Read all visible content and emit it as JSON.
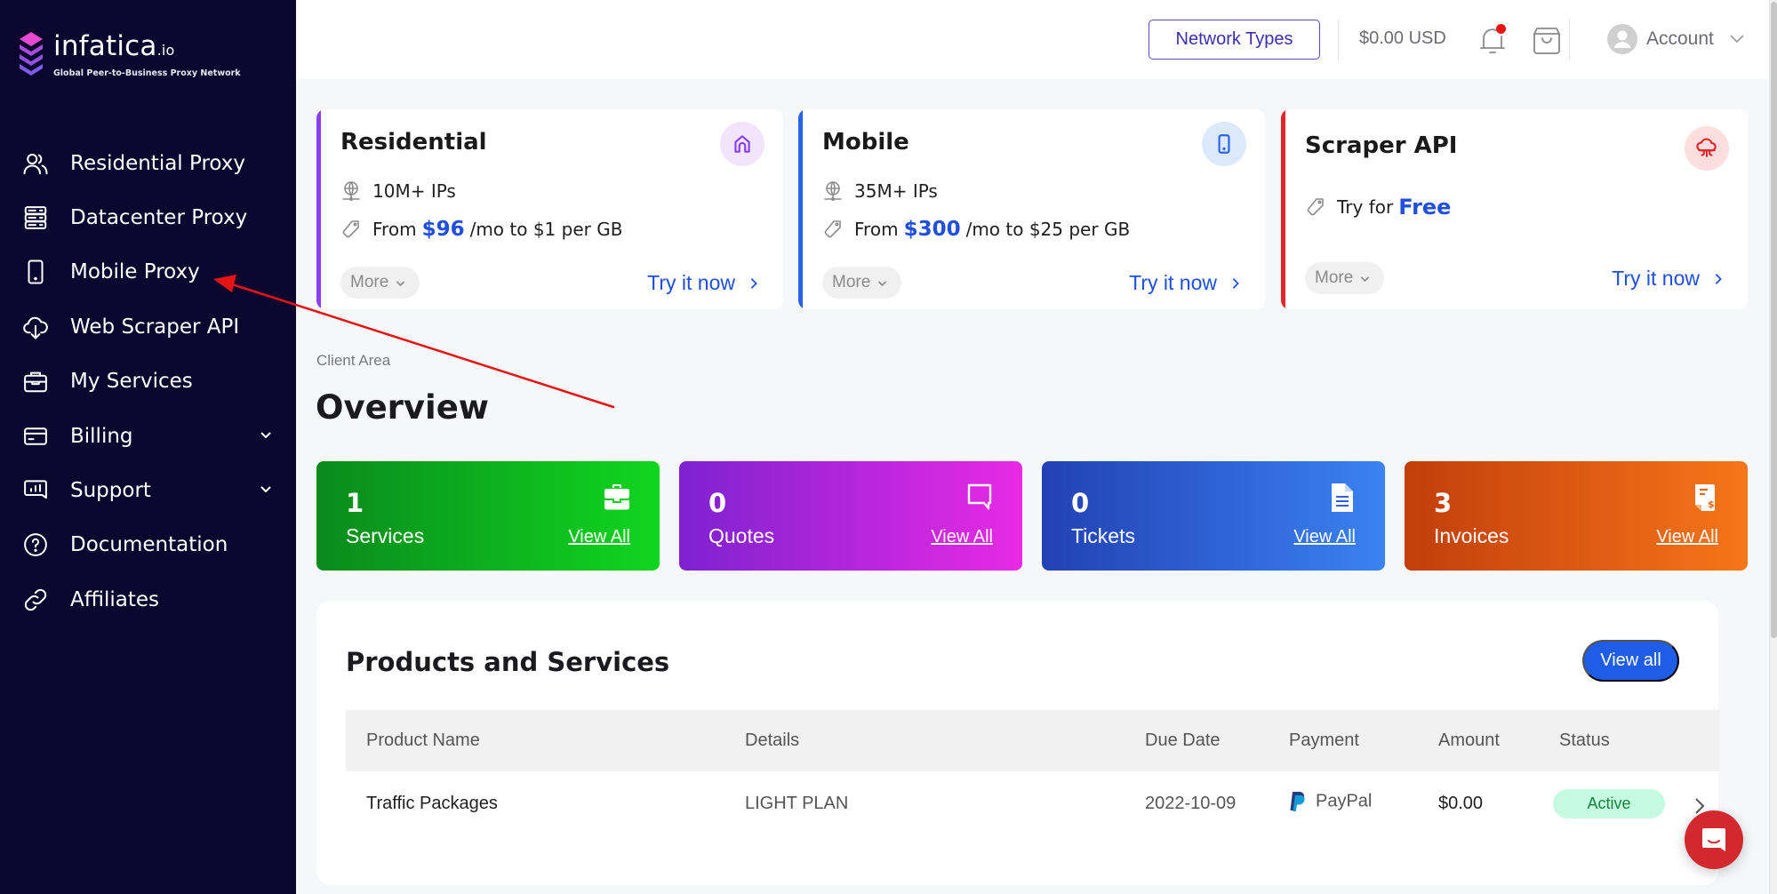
{
  "brand": {
    "name": "infatica",
    "suffix": ".io",
    "tagline": "Global Peer-to-Business Proxy Network"
  },
  "sidebar": {
    "items": [
      {
        "label": "Residential Proxy",
        "icon": "users-icon"
      },
      {
        "label": "Datacenter Proxy",
        "icon": "server-icon"
      },
      {
        "label": "Mobile Proxy",
        "icon": "mobile-icon"
      },
      {
        "label": "Web Scraper API",
        "icon": "cloud-download-icon"
      },
      {
        "label": "My Services",
        "icon": "briefcase-icon"
      },
      {
        "label": "Billing",
        "icon": "credit-card-icon",
        "expandable": true
      },
      {
        "label": "Support",
        "icon": "chart-message-icon",
        "expandable": true
      },
      {
        "label": "Documentation",
        "icon": "help-circle-icon"
      },
      {
        "label": "Affiliates",
        "icon": "link-icon"
      }
    ]
  },
  "header": {
    "network_types_label": "Network Types",
    "balance": "$0.00 USD",
    "notifications_unread": true,
    "account_label": "Account"
  },
  "product_cards": [
    {
      "title": "Residential",
      "accent": "#8a3ff0",
      "icon": "home-icon",
      "ips": "10M+ IPs",
      "price_prefix": "From",
      "price_highlight": "$96",
      "price_suffix": "/mo to $1 per GB",
      "more_label": "More",
      "cta_label": "Try it now"
    },
    {
      "title": "Mobile",
      "accent": "#2a63e8",
      "icon": "mobile-icon",
      "ips": "35M+ IPs",
      "price_prefix": "From",
      "price_highlight": "$300",
      "price_suffix": "/mo to $25 per GB",
      "more_label": "More",
      "cta_label": "Try it now"
    },
    {
      "title": "Scraper API",
      "accent": "#e0262b",
      "icon": "cloud-spider-icon",
      "price_prefix": "Try for",
      "price_highlight": "Free",
      "more_label": "More",
      "cta_label": "Try it now"
    }
  ],
  "breadcrumb": "Client Area",
  "page_title": "Overview",
  "stats": [
    {
      "count": "1",
      "label": "Services",
      "link": "View All",
      "icon": "briefcase-icon",
      "color_from": "#098a1d",
      "color_to": "#10d61f"
    },
    {
      "count": "0",
      "label": "Quotes",
      "link": "View All",
      "icon": "comment-icon",
      "color_from": "#7d22d0",
      "color_to": "#e82ae6"
    },
    {
      "count": "0",
      "label": "Tickets",
      "link": "View All",
      "icon": "document-icon",
      "color_from": "#2241b4",
      "color_to": "#3b82f2"
    },
    {
      "count": "3",
      "label": "Invoices",
      "link": "View All",
      "icon": "invoice-icon",
      "color_from": "#c23e0b",
      "color_to": "#f5761a"
    }
  ],
  "products": {
    "title": "Products and Services",
    "view_all_label": "View all",
    "columns": [
      "Product Name",
      "Details",
      "Due Date",
      "Payment",
      "Amount",
      "Status"
    ],
    "rows": [
      {
        "product_name": "Traffic Packages",
        "details": "LIGHT PLAN",
        "due_date": "2022-10-09",
        "payment": "PayPal",
        "amount": "$0.00",
        "status": "Active"
      }
    ]
  }
}
